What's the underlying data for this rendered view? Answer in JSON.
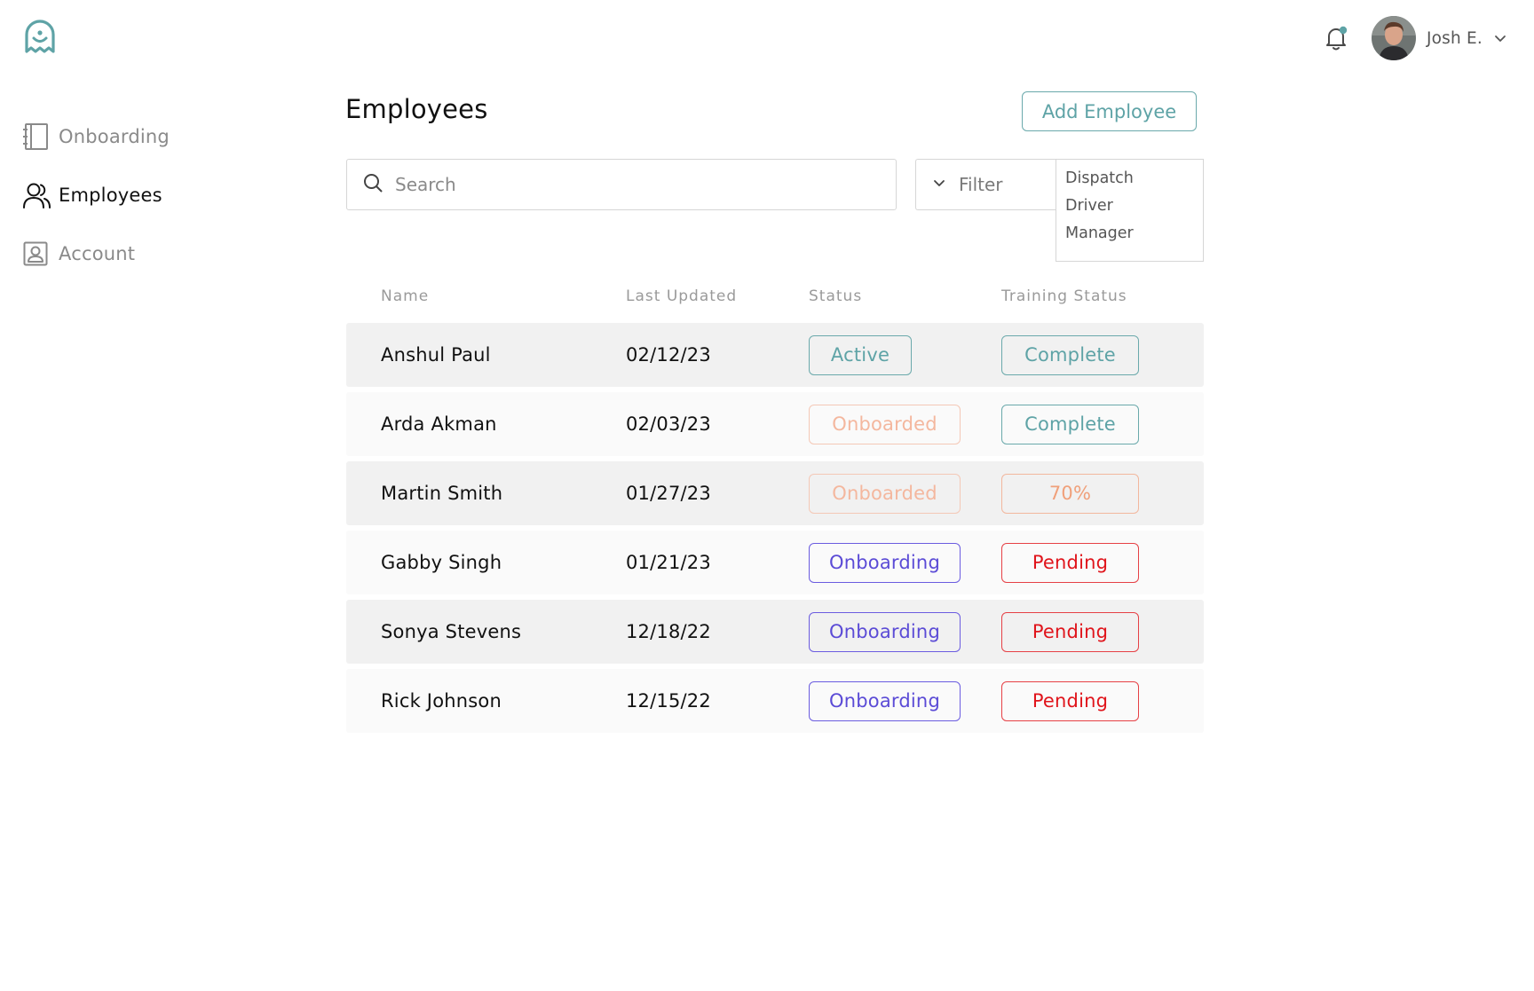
{
  "user": {
    "name": "Josh E."
  },
  "sidebar": {
    "items": [
      {
        "label": "Onboarding",
        "icon": "notebook-icon",
        "active": false
      },
      {
        "label": "Employees",
        "icon": "users-icon",
        "active": true
      },
      {
        "label": "Account",
        "icon": "account-card-icon",
        "active": false
      }
    ]
  },
  "main": {
    "title": "Employees",
    "add_button": "Add Employee",
    "search_placeholder": "Search",
    "filter_label": "Filter",
    "filter_options": [
      "Dispatch",
      "Driver",
      "Manager"
    ]
  },
  "table": {
    "headers": [
      "Name",
      "Last Updated",
      "Status",
      "Training Status"
    ],
    "rows": [
      {
        "name": "Anshul Paul",
        "date": "02/12/23",
        "status": "Active",
        "training": "Complete"
      },
      {
        "name": "Arda Akman",
        "date": "02/03/23",
        "status": "Onboarded",
        "training": "Complete"
      },
      {
        "name": "Martin Smith",
        "date": "01/27/23",
        "status": "Onboarded",
        "training": "70%"
      },
      {
        "name": "Gabby Singh",
        "date": "01/21/23",
        "status": "Onboarding",
        "training": "Pending"
      },
      {
        "name": "Sonya Stevens",
        "date": "12/18/22",
        "status": "Onboarding",
        "training": "Pending"
      },
      {
        "name": "Rick Johnson",
        "date": "12/15/22",
        "status": "Onboarding",
        "training": "Pending"
      }
    ]
  },
  "colors": {
    "accent_teal": "#5ea3a6",
    "onboarded_peach": "#f4b79e",
    "onboarding_purple": "#5b4bd6",
    "pending_red": "#e0141b",
    "notification_dot": "#5ea3a6"
  }
}
